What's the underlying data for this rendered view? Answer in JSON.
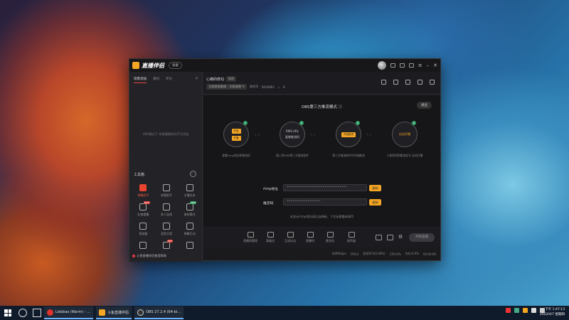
{
  "app": {
    "name": "直播伴侣",
    "version_pill": "旗舰",
    "left_tabs": [
      "场景添加",
      "素材",
      "评论"
    ],
    "left_empty_text": "OBS模式下 待直播素材均不可添加",
    "tools_title": "工具箱",
    "tools_more": "⋯",
    "tools": [
      {
        "label": "弹幕助手",
        "badge": "",
        "active": true
      },
      {
        "label": "房管助手",
        "badge": "",
        "active": false
      },
      {
        "label": "主播任务",
        "badge": "",
        "active": false
      },
      {
        "label": "礼物提醒",
        "badge": "NEW",
        "active": false
      },
      {
        "label": "多人连线",
        "badge": "",
        "active": false
      },
      {
        "label": "收听模式",
        "badge": "NEW",
        "active": false
      },
      {
        "label": "观测器",
        "badge": "",
        "active": false
      },
      {
        "label": "语音方案",
        "badge": "",
        "active": false
      },
      {
        "label": "弹幕互动",
        "badge": "",
        "active": false
      },
      {
        "label": "",
        "badge": "",
        "active": false
      },
      {
        "label": "",
        "badge": "HOT",
        "active": false
      },
      {
        "label": "",
        "badge": "",
        "active": false
      }
    ],
    "left_footer": "斗鱼直播伴侣使用帮助",
    "header": {
      "room_title": "心痛的修勾",
      "room_tag": "修改",
      "category": "主机其他游戏 - 主机其他 ✎",
      "room_id_label": "房间号",
      "room_id": "5420661",
      "heat": "0"
    },
    "obs": {
      "title": "OBS第三方推流模式 ⓘ",
      "exit_label": "退出",
      "steps": [
        {
          "num": "1",
          "buttons": [
            "开启",
            "开播"
          ],
          "desc": "查看rtmp地址和推流码"
        },
        {
          "num": "2",
          "lines": [
            "RMS URL",
            "复制推流码"
          ],
          "desc": "填入到OBS第三方推流软件"
        },
        {
          "num": "3",
          "button": "开始推流",
          "desc": "第三方推流软件内开始推流"
        },
        {
          "num": "4",
          "text": "自动开播",
          "desc": "斗鱼检测到推流信号 自动开播"
        }
      ],
      "rtmp_label": "rtmp地址",
      "rtmp_value": "••••••••••••••••••••••••••••••••",
      "key_label": "推流码",
      "key_value": "••••••••••••••••••",
      "copy_label": "复制",
      "hint": "未显示rtmp地址请点击刷新，下次无需重新填写"
    },
    "bottom_items": [
      "直播间管理",
      "高级设",
      "互动玩法",
      "直播间",
      "麦克风",
      "扬声器"
    ],
    "start_live": "开始直播",
    "status": [
      "码率0kbps",
      "FPS:0",
      "丢帧率:0(0.00%)",
      "CPU:0%",
      "内存:0.0%",
      "00:00:00"
    ]
  },
  "taskbar": {
    "apps": [
      {
        "label": "Liebbas (Warm) - ...",
        "color": "#e0332f"
      },
      {
        "label": "斗鱼直播伴侣",
        "color": "#f5a623"
      },
      {
        "label": "OBS 27.2.4 (64-bi...",
        "color": "#333333"
      }
    ],
    "time": "下午 1:47:13",
    "date": "2022/4/7 星期四"
  }
}
